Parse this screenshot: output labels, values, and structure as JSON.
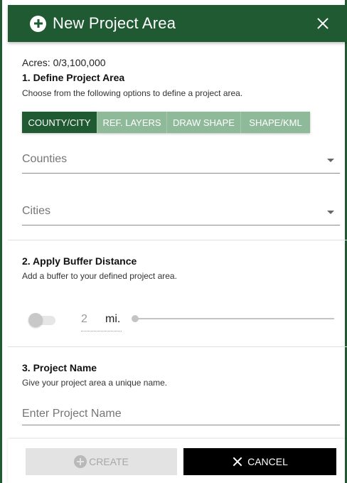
{
  "header": {
    "title": "New Project Area",
    "plus_icon": "plus-circle-icon",
    "close_icon": "close-icon",
    "background_color": "#1f5a32"
  },
  "acres": {
    "label": "Acres: 0/3,100,000"
  },
  "section1": {
    "title": "1. Define Project Area",
    "description": "Choose from the following options to define a project area.",
    "tabs": [
      {
        "label": "COUNTY/CITY",
        "active": true
      },
      {
        "label": "REF. LAYERS",
        "active": false
      },
      {
        "label": "DRAW SHAPE",
        "active": false
      },
      {
        "label": "SHAPE/KML",
        "active": false
      }
    ],
    "counties_select": {
      "placeholder": "Counties"
    },
    "cities_select": {
      "placeholder": "Cities"
    }
  },
  "section2": {
    "title": "2. Apply Buffer Distance",
    "description": "Add a buffer to your defined project area.",
    "buffer_enabled": false,
    "buffer_value": "2",
    "buffer_unit": "mi.",
    "slider_level": 0
  },
  "section3": {
    "title": "3. Project Name",
    "description": "Give your project area a unique name.",
    "name_input": {
      "value": "",
      "placeholder": "Enter Project Name"
    }
  },
  "footer": {
    "create_label": "CREATE",
    "create_enabled": false,
    "cancel_label": "CANCEL"
  },
  "colors": {
    "primary": "#1f5a32",
    "tab_inactive": "#8fba99",
    "disabled": "#e3e3e3",
    "cancel": "#000000"
  }
}
